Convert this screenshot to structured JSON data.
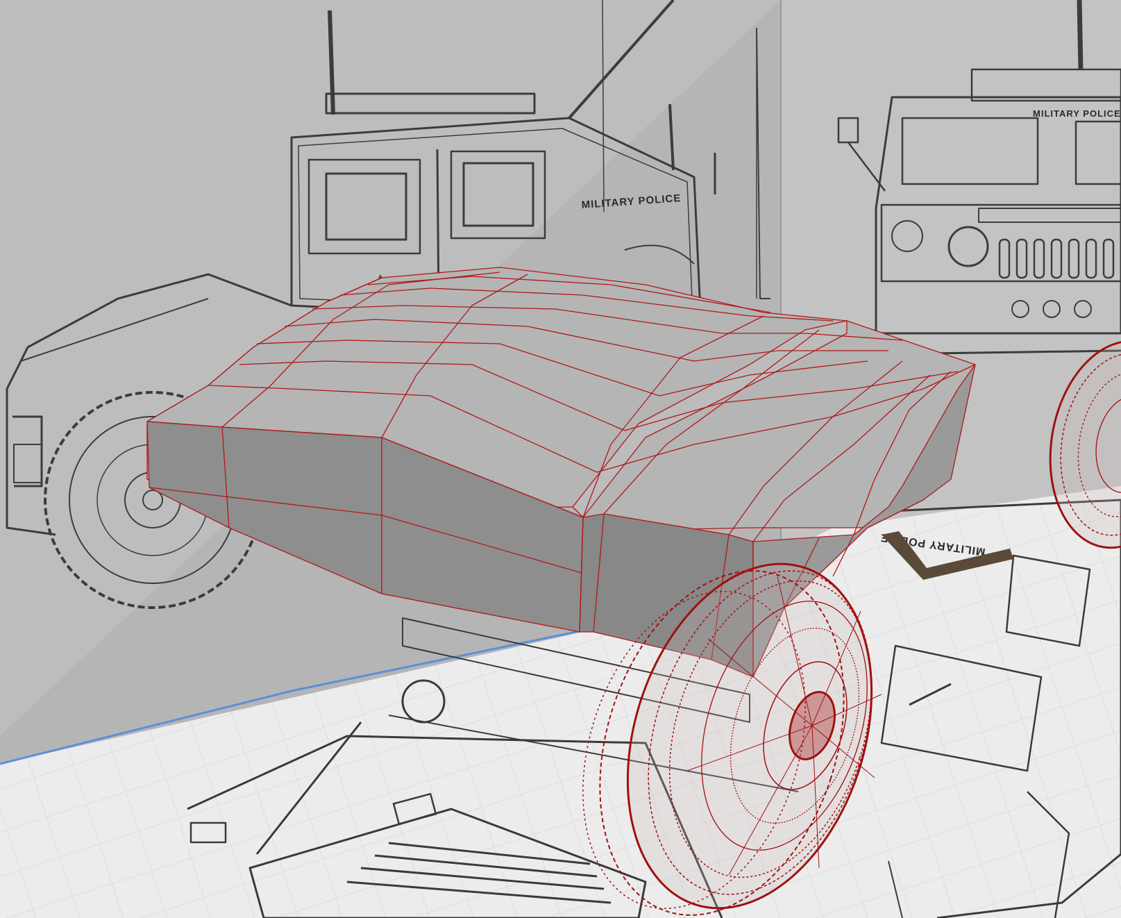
{
  "viewport": {
    "name": "3D modeling perspective viewport",
    "mode": "shaded with wireframe overlay",
    "wire_color": "#b01818",
    "mesh_color": "#b4b4b4",
    "background_color": "#b9b9b9",
    "floor_color": "#ececec",
    "grid_color": "#c9c9c9",
    "floor_edge_color": "#5b8fd6"
  },
  "reference_images": {
    "side_view_label": "MILITARY POLICE",
    "front_view_label": "MILITARY POLICE",
    "top_view_label": "MILITARY POLICE"
  }
}
